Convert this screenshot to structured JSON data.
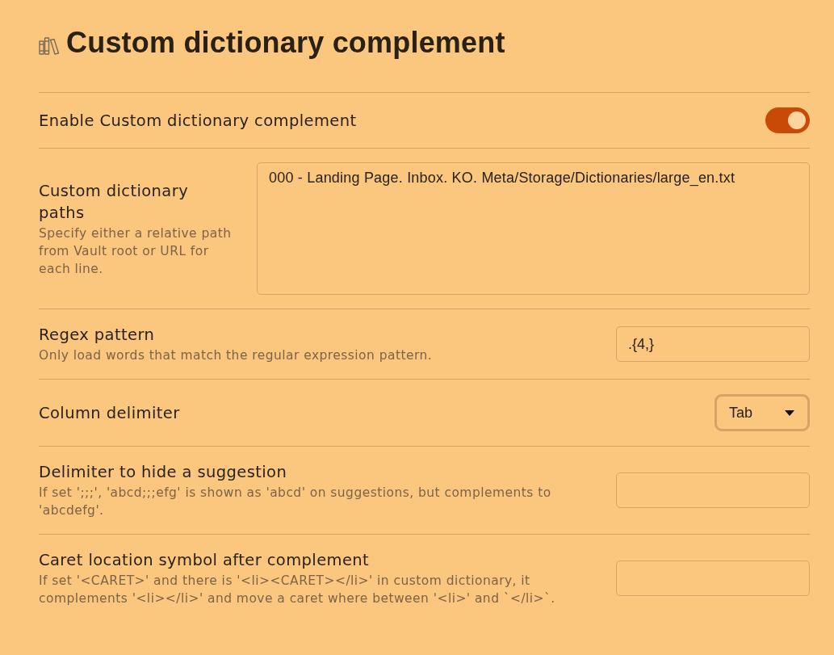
{
  "heading": {
    "title": "Custom dictionary complement"
  },
  "settings": [
    {
      "kind": "toggle",
      "name": "Enable Custom dictionary complement",
      "on": true
    },
    {
      "kind": "textarea",
      "name": "Custom dictionary paths",
      "description": "Specify either a relative path from Vault root or URL for each line.",
      "value": "000 - Landing Page. Inbox. KO. Meta/Storage/Dictionaries/large_en.txt"
    },
    {
      "kind": "text",
      "name": "Regex pattern",
      "description": "Only load words that match the regular expression pattern.",
      "value": ".{4,}"
    },
    {
      "kind": "dropdown",
      "name": "Column delimiter",
      "value": "Tab"
    },
    {
      "kind": "text",
      "name": "Delimiter to hide a suggestion",
      "description": "If set ';;;', 'abcd;;;efg' is shown as 'abcd' on suggestions, but complements to 'abcdefg'."
    },
    {
      "kind": "text",
      "name": "Caret location symbol after complement",
      "description": "If set '<CARET>' and there is '<li><CARET></li>' in custom dictionary, it complements '<li></li>' and move a caret where between '<li>' and `</li>`."
    }
  ]
}
